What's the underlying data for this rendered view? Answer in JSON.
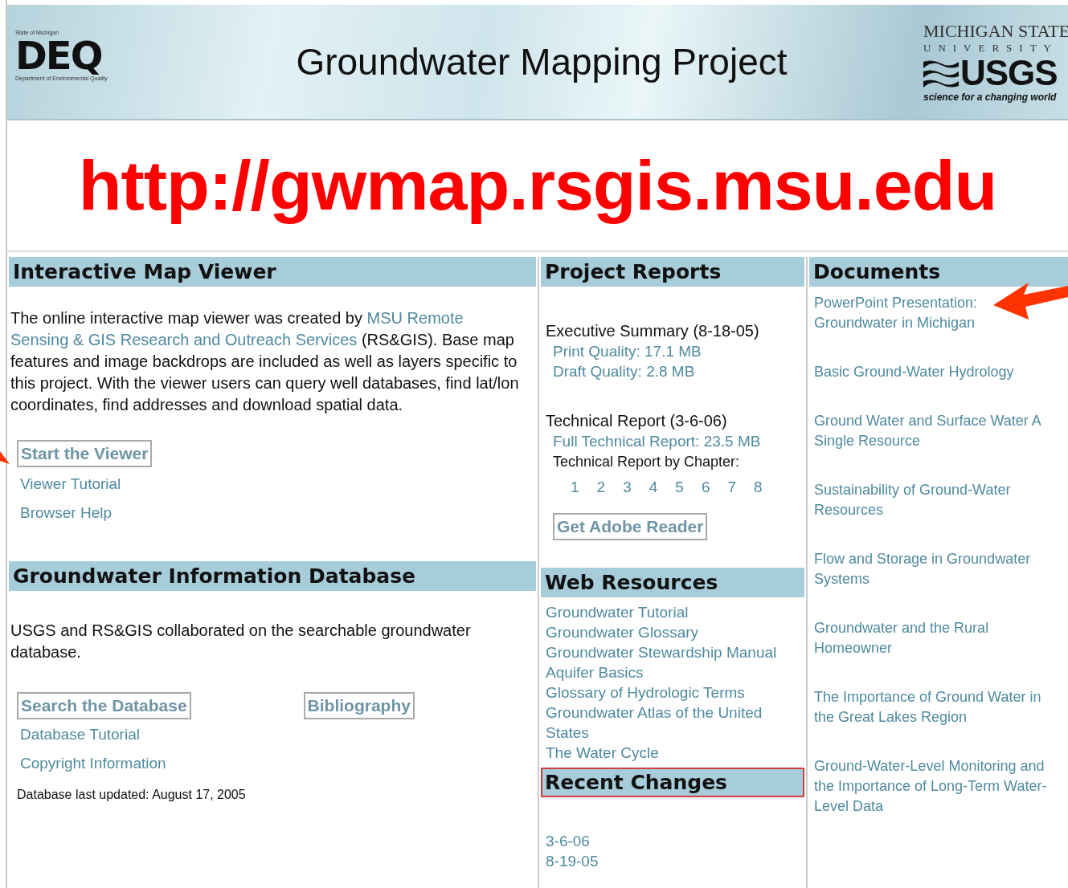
{
  "header": {
    "deq": {
      "caption_top": "State of Michigan",
      "letters": "DEQ",
      "caption_bottom": "Department of Environmental Quality"
    },
    "title": "Groundwater Mapping Project",
    "msu": {
      "line1": "MICHIGAN STATE",
      "line2": "UNIVERSITY"
    },
    "usgs": {
      "name": "USGS",
      "tagline": "science for a changing world"
    }
  },
  "url": "http://gwmap.rsgis.msu.edu",
  "map_viewer": {
    "heading": "Interactive Map Viewer",
    "paragraph": {
      "text_before": "The online interactive map viewer was created by",
      "links": [
        "MSU Remote",
        "Sensing & GIS Research and Outreach Services"
      ],
      "text_after": "(RS&GIS). Base map features and image backdrops are included as well as layers specific to this project. With the viewer users can query well databases, find lat/lon coordinates, find addresses and download spatial data."
    },
    "button": "Start the Viewer",
    "links": [
      "Viewer Tutorial",
      "Browser Help"
    ]
  },
  "database": {
    "heading": "Groundwater Information Database",
    "paragraph": "USGS and RS&GIS collaborated on the searchable groundwater database.",
    "buttons": [
      "Search the Database",
      "Bibliography"
    ],
    "links": [
      "Database Tutorial",
      "Copyright Information"
    ],
    "updated": "Database last updated: August 17, 2005"
  },
  "project_reports": {
    "heading": "Project Reports",
    "executive": {
      "title": "Executive Summary (8-18-05)",
      "links": [
        "Print Quality: 17.1 MB",
        "Draft Quality: 2.8 MB"
      ]
    },
    "technical": {
      "title": "Technical Report (3-6-06)",
      "links": [
        "Full Technical Report: 23.5 MB"
      ],
      "chapter_label": "Technical Report by Chapter:",
      "chapters": [
        "1",
        "2",
        "3",
        "4",
        "5",
        "6",
        "7",
        "8"
      ]
    },
    "button": "Get Adobe Reader"
  },
  "web_resources": {
    "heading": "Web Resources",
    "links": [
      "Groundwater Tutorial",
      "Groundwater Glossary",
      "Groundwater Stewardship Manual",
      "Aquifer Basics",
      "Glossary of Hydrologic Terms",
      "Groundwater Atlas of the United States",
      "The Water Cycle"
    ]
  },
  "recent_changes": {
    "heading": "Recent Changes",
    "highlighted": true,
    "dates": [
      "3-6-06",
      "8-19-05"
    ]
  },
  "documents": {
    "heading": "Documents",
    "links": [
      "PowerPoint Presentation: Groundwater in Michigan",
      "Basic Ground-Water Hydrology",
      "Ground Water and Surface Water A Single Resource",
      "Sustainability of Ground-Water Resources",
      "Flow and Storage in Groundwater Systems",
      "Groundwater and the Rural Homeowner",
      "The Importance of Ground Water in the Great Lakes Region",
      "Ground-Water-Level Monitoring and the Importance of Long-Term Water-Level Data"
    ]
  }
}
